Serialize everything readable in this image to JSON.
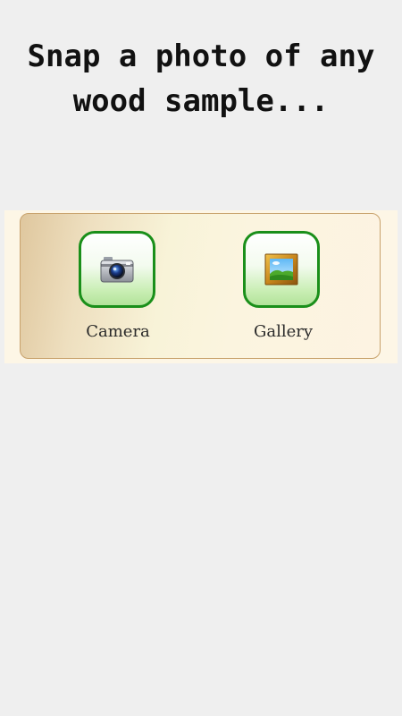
{
  "headline": {
    "line1": "Snap a photo of any",
    "line2": "wood sample..."
  },
  "options": {
    "camera": {
      "label": "Camera",
      "icon": "camera-icon"
    },
    "gallery": {
      "label": "Gallery",
      "icon": "picture-frame-icon"
    }
  },
  "colors": {
    "background": "#efefef",
    "tile_border": "#1a8f1a",
    "panel_border": "#c8a26c"
  }
}
